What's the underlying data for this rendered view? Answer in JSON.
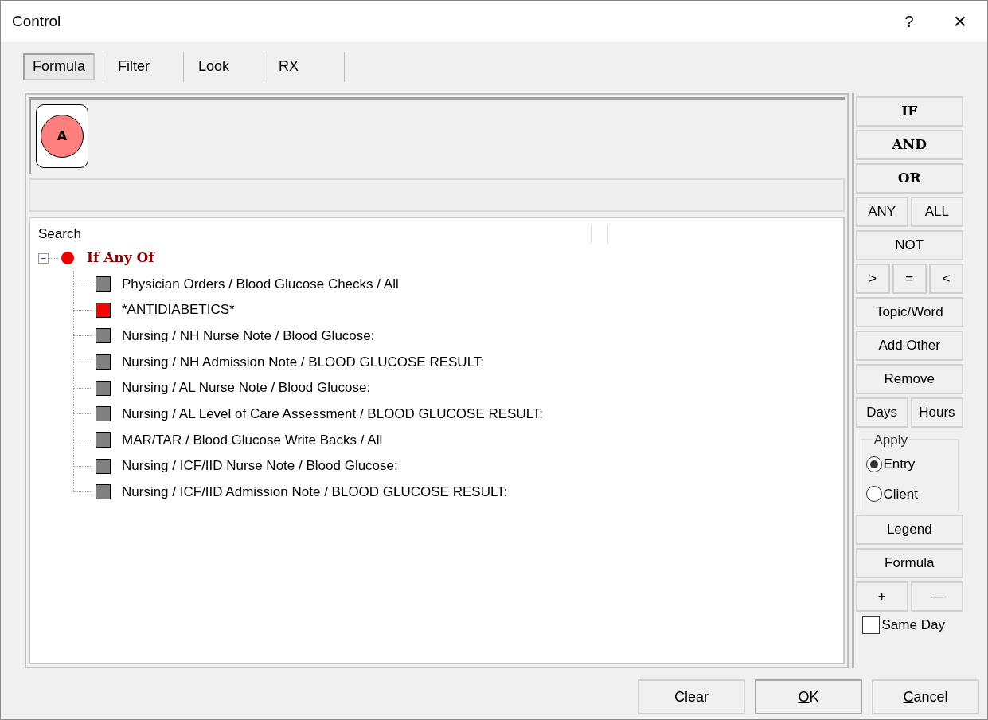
{
  "window": {
    "title": "Control",
    "help": "?",
    "close": "×"
  },
  "tabs": [
    {
      "label": "Formula",
      "selected": true
    },
    {
      "label": "Filter",
      "selected": false
    },
    {
      "label": "Look",
      "selected": false
    },
    {
      "label": "RX",
      "selected": false
    }
  ],
  "formula_tokens": [
    {
      "label": "A",
      "color": "#ff7f7f"
    }
  ],
  "tree": {
    "header": "Search",
    "root": {
      "label": "If Any Of",
      "expanded": true,
      "color": "#ee0000",
      "children": [
        {
          "label": "Physician Orders / Blood Glucose Checks / All",
          "color": "#808080"
        },
        {
          "label": "*ANTIDIABETICS*",
          "color": "#ff0000"
        },
        {
          "label": "Nursing / NH Nurse Note / Blood Glucose:",
          "color": "#808080"
        },
        {
          "label": "Nursing / NH Admission Note / BLOOD GLUCOSE RESULT:",
          "color": "#808080"
        },
        {
          "label": "Nursing / AL Nurse Note / Blood Glucose:",
          "color": "#808080"
        },
        {
          "label": "Nursing / AL Level of Care Assessment / BLOOD GLUCOSE RESULT:",
          "color": "#808080"
        },
        {
          "label": "MAR/TAR / Blood Glucose Write Backs / All",
          "color": "#808080"
        },
        {
          "label": "Nursing / ICF/IID Nurse Note / Blood Glucose:",
          "color": "#808080"
        },
        {
          "label": "Nursing / ICF/IID Admission Note / BLOOD GLUCOSE RESULT:",
          "color": "#808080"
        }
      ]
    }
  },
  "tools": [
    {
      "kind": "row",
      "buttons": [
        {
          "label": "IF",
          "bold": true
        }
      ]
    },
    {
      "kind": "row",
      "buttons": [
        {
          "label": "AND",
          "bold": true
        }
      ]
    },
    {
      "kind": "row",
      "buttons": [
        {
          "label": "OR",
          "bold": true
        }
      ]
    },
    {
      "kind": "row",
      "buttons": [
        {
          "label": "ANY",
          "bold": false
        },
        {
          "label": "ALL",
          "bold": false
        }
      ]
    },
    {
      "kind": "row",
      "buttons": [
        {
          "label": "NOT",
          "bold": false
        }
      ]
    },
    {
      "kind": "row",
      "buttons": [
        {
          "label": ">",
          "bold": false
        },
        {
          "label": "=",
          "bold": false
        },
        {
          "label": "<",
          "bold": false
        }
      ]
    },
    {
      "kind": "row",
      "buttons": [
        {
          "label": "Topic/Word",
          "bold": false
        }
      ]
    },
    {
      "kind": "row",
      "buttons": [
        {
          "label": "Add Other",
          "bold": false
        }
      ]
    },
    {
      "kind": "row",
      "buttons": [
        {
          "label": "Remove",
          "bold": false
        }
      ]
    },
    {
      "kind": "row",
      "buttons": [
        {
          "label": "Days",
          "bold": false
        },
        {
          "label": "Hours",
          "bold": false
        }
      ]
    },
    {
      "kind": "group",
      "title": "Apply",
      "options": [
        {
          "label": "Entry",
          "selected": true
        },
        {
          "label": "Client",
          "selected": false
        }
      ]
    },
    {
      "kind": "row",
      "buttons": [
        {
          "label": "Legend",
          "bold": false
        }
      ]
    },
    {
      "kind": "row",
      "buttons": [
        {
          "label": "Formula",
          "bold": false
        }
      ]
    },
    {
      "kind": "row",
      "buttons": [
        {
          "label": "+",
          "bold": false
        },
        {
          "label": "—",
          "bold": false
        }
      ]
    },
    {
      "kind": "check",
      "label": "Same Day",
      "checked": false
    }
  ],
  "footer_buttons": [
    {
      "label": "Clear",
      "underline_first": false,
      "default": false
    },
    {
      "label": "OK",
      "underline_first": true,
      "default": true
    },
    {
      "label": "Cancel",
      "underline_first": true,
      "default": false
    }
  ]
}
